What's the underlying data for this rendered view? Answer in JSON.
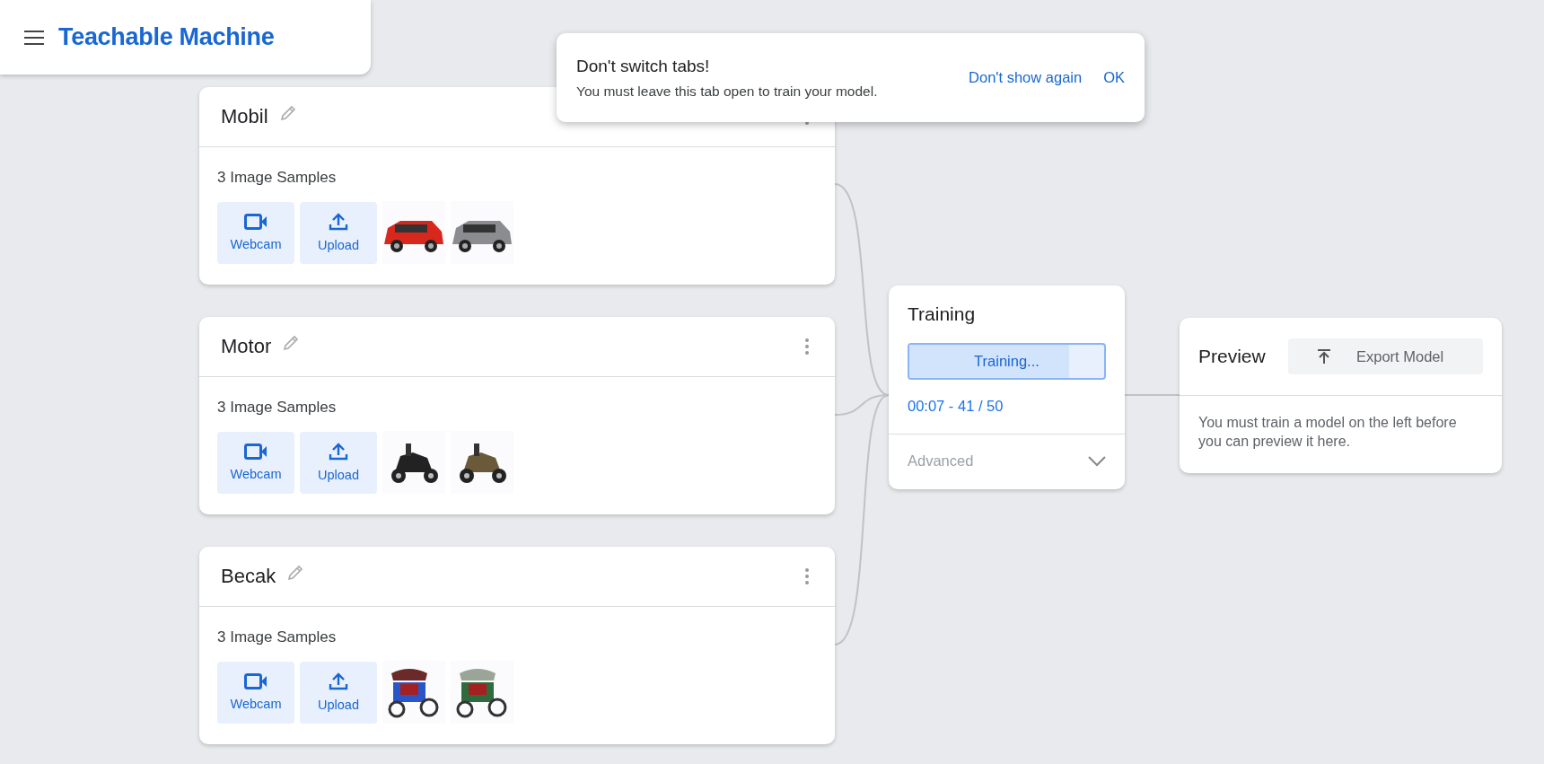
{
  "header": {
    "title": "Teachable Machine"
  },
  "toast": {
    "title": "Don't switch tabs!",
    "message": "You must leave this tab open to train your model.",
    "actions": [
      "Don't show again",
      "OK"
    ]
  },
  "classes": [
    {
      "name": "Mobil",
      "count": "3 Image Samples",
      "buttons": [
        "Webcam",
        "Upload"
      ],
      "samples": [
        {
          "kind": "picture"
        },
        {
          "kind": "picture"
        }
      ]
    },
    {
      "name": "Motor",
      "count": "3 Image Samples",
      "buttons": [
        "Webcam",
        "Upload"
      ],
      "samples": [
        {
          "kind": "picture"
        },
        {
          "kind": "picture"
        }
      ]
    },
    {
      "name": "Becak",
      "count": "3 Image Samples",
      "buttons": [
        "Webcam",
        "Upload"
      ],
      "samples": [
        {
          "kind": "picture"
        },
        {
          "kind": "picture"
        }
      ]
    }
  ],
  "training": {
    "title": "Training",
    "button": "Training...",
    "level": 0.82,
    "progress": "00:07 - 41 / 50",
    "advanced": "Advanced",
    "expanded": false
  },
  "preview": {
    "title": "Preview",
    "export": "Export Model",
    "message": "You must train a model on the left before you can preview it here."
  }
}
